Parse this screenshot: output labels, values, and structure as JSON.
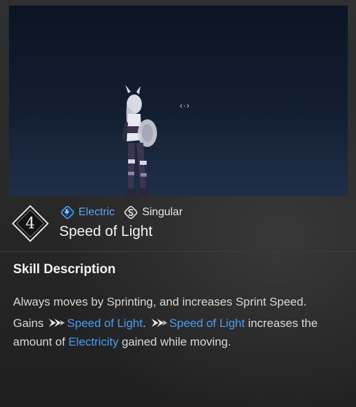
{
  "preview": {
    "rotate_hint": "‹·›"
  },
  "skill": {
    "tier": "4",
    "element_tag": "Electric",
    "rarity_tag": "Singular",
    "name": "Speed of Light"
  },
  "description": {
    "heading": "Skill Description",
    "line1": "Always moves by Sprinting, and increases Sprint Speed.",
    "gains_prefix": "Gains",
    "buff_name_1": "Speed of Light",
    "period": ".",
    "buff_name_2": "Speed of Light",
    "mid_text": "increases the amount of",
    "resource_name": "Electricity",
    "tail_text": "gained while moving."
  },
  "colors": {
    "highlight": "#4c9cf5",
    "electric": "#5aa6ff",
    "background": "#262626"
  },
  "icons": {
    "element": "electric-icon",
    "rarity": "singular-icon",
    "buff": "speed-arrows-icon"
  }
}
